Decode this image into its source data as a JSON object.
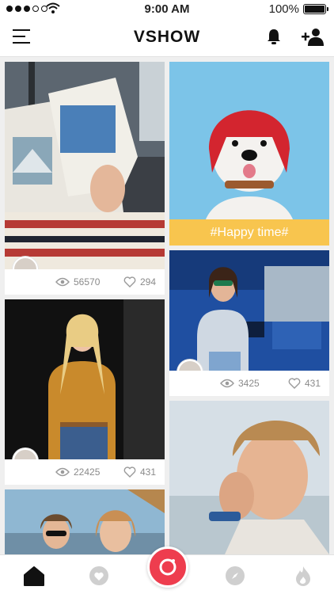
{
  "status_bar": {
    "time": "9:00 AM",
    "battery": "100%"
  },
  "nav": {
    "title": "VSHOW"
  },
  "feed": {
    "posts": [
      {
        "views": "56570",
        "likes": "294"
      },
      {
        "tag": "#Happy time#"
      },
      {
        "views": "3425",
        "likes": "431"
      },
      {
        "views": "22425",
        "likes": "431"
      }
    ]
  },
  "tabbar": {
    "items": [
      "home-icon",
      "heart-icon",
      "camera-icon",
      "compass-icon",
      "flame-icon"
    ]
  },
  "colors": {
    "accent": "#ee3d4e",
    "tag_strip": "#f8c54e",
    "stat_text": "#8a8a8a"
  }
}
